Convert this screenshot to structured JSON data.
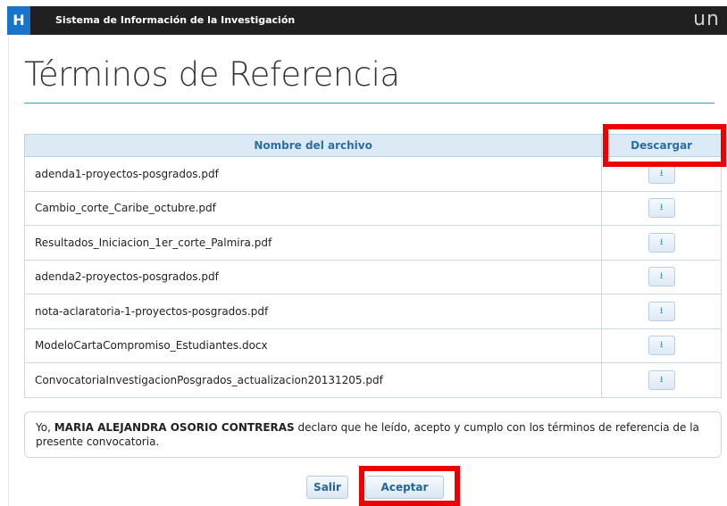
{
  "header": {
    "logo_letter": "H",
    "title": "Sistema de Información de la Investigación",
    "brand_mark": "un"
  },
  "page": {
    "title": "Términos de Referencia"
  },
  "table": {
    "columns": [
      "Nombre del archivo",
      "Descargar"
    ],
    "rows": [
      {
        "file": "adenda1-proyectos-posgrados.pdf",
        "download_icon": "download-icon"
      },
      {
        "file": "Cambio_corte_Caribe_octubre.pdf",
        "download_icon": "download-icon"
      },
      {
        "file": "Resultados_Iniciacion_1er_corte_Palmira.pdf",
        "download_icon": "download-icon"
      },
      {
        "file": "adenda2-proyectos-posgrados.pdf",
        "download_icon": "download-icon"
      },
      {
        "file": "nota-aclaratoria-1-proyectos-posgrados.pdf",
        "download_icon": "download-icon"
      },
      {
        "file": "ModeloCartaCompromiso_Estudiantes.docx",
        "download_icon": "download-icon"
      },
      {
        "file": "ConvocatoriaInvestigacionPosgrados_actualizacion20131205.pdf",
        "download_icon": "download-icon"
      }
    ]
  },
  "declaration": {
    "prefix": "Yo, ",
    "name": "MARIA ALEJANDRA OSORIO CONTRERAS",
    "suffix": " declaro que he leído, acepto y cumplo con los términos de referencia de la presente convocatoria."
  },
  "actions": {
    "exit_label": "Salir",
    "accept_label": "Aceptar"
  },
  "colors": {
    "highlight": "#ee0000",
    "accent": "#3ba3d0",
    "header_bg": "#202020",
    "logo_blue": "#1a73c9"
  }
}
